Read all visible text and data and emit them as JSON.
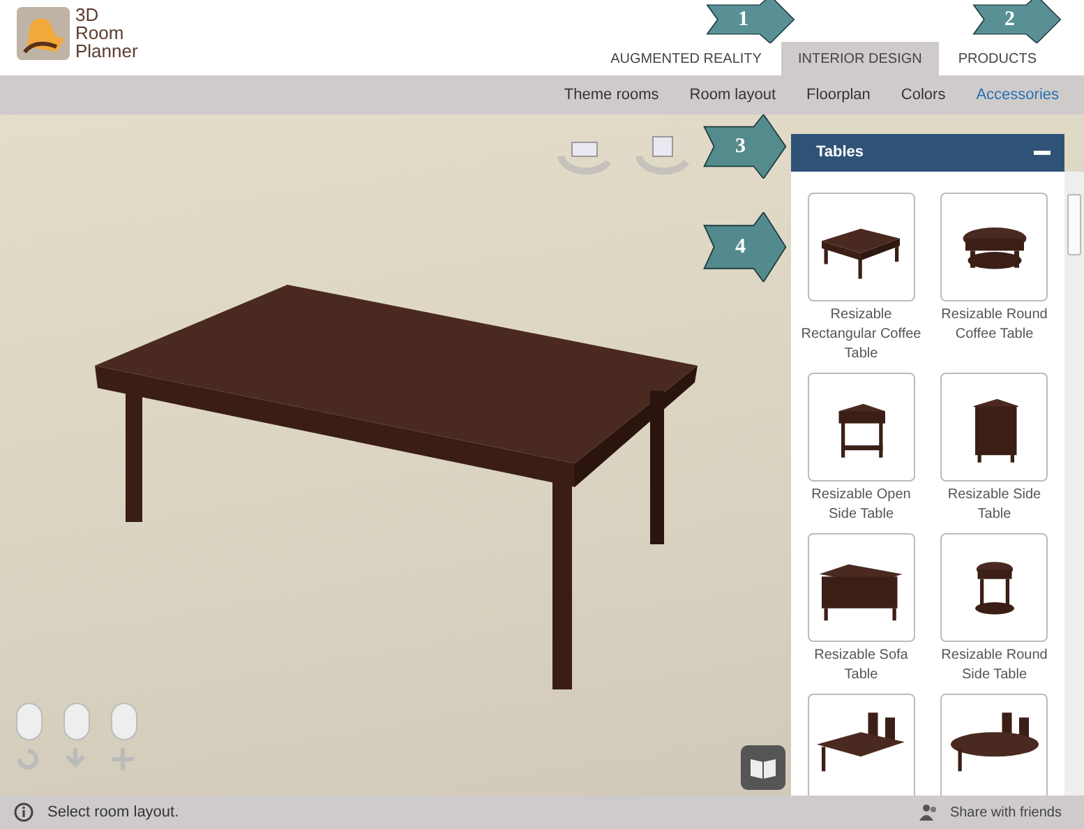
{
  "logo": {
    "lines": [
      "3D",
      "Room",
      "Planner"
    ]
  },
  "main_nav": [
    {
      "label": "AUGMENTED REALITY",
      "selected": false
    },
    {
      "label": "INTERIOR DESIGN",
      "selected": true
    },
    {
      "label": "PRODUCTS",
      "selected": false
    }
  ],
  "sub_nav": [
    {
      "label": "Theme rooms",
      "selected": false
    },
    {
      "label": "Room layout",
      "selected": false
    },
    {
      "label": "Floorplan",
      "selected": false
    },
    {
      "label": "Colors",
      "selected": false
    },
    {
      "label": "Accessories",
      "selected": true
    }
  ],
  "callouts": [
    {
      "number": "1"
    },
    {
      "number": "2"
    },
    {
      "number": "3"
    },
    {
      "number": "4"
    }
  ],
  "panel": {
    "title": "Tables",
    "expanded": true,
    "items": [
      {
        "kind": "rect-coffee",
        "label": "Resizable Rectangular Coffee Table"
      },
      {
        "kind": "round-coffee",
        "label": "Resizable Round Coffee Table"
      },
      {
        "kind": "open-side",
        "label": "Resizable Open Side Table"
      },
      {
        "kind": "side",
        "label": "Resizable Side Table"
      },
      {
        "kind": "sofa",
        "label": "Resizable Sofa Table"
      },
      {
        "kind": "round-side",
        "label": "Resizable Round Side Table"
      },
      {
        "kind": "dining"
      },
      {
        "kind": "dining-oval"
      }
    ]
  },
  "status_bar": {
    "message": "Select room layout.",
    "share": "Share with friends"
  }
}
